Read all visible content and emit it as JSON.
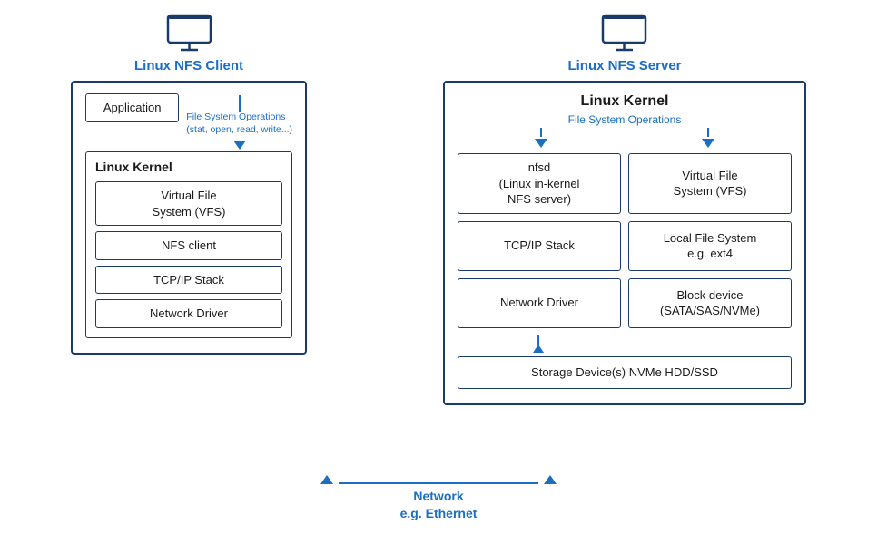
{
  "left": {
    "title": "Linux NFS Client",
    "outer_label": "",
    "app_label": "Application",
    "fs_ops_label": "File System Operations\n(stat, open, read, write...)",
    "kernel_title": "Linux Kernel",
    "kernel_items": [
      "Virtual File\nSystem (VFS)",
      "NFS client",
      "TCP/IP Stack",
      "Network Driver"
    ]
  },
  "right": {
    "title": "Linux NFS Server",
    "kernel_title": "Linux Kernel",
    "fs_ops_label": "File System Operations",
    "grid_items": [
      "nfsd\n(Linux in-kernel\nNFS server)",
      "Virtual File\nSystem (VFS)",
      "TCP/IP Stack",
      "Local File System\ne.g. ext4",
      "Network Driver",
      "Block device\n(SATA/SAS/NVMe)"
    ],
    "storage_label": "Storage Device(s)\nNVMe\nHDD/SSD"
  },
  "network": {
    "label": "Network\ne.g. Ethernet"
  }
}
